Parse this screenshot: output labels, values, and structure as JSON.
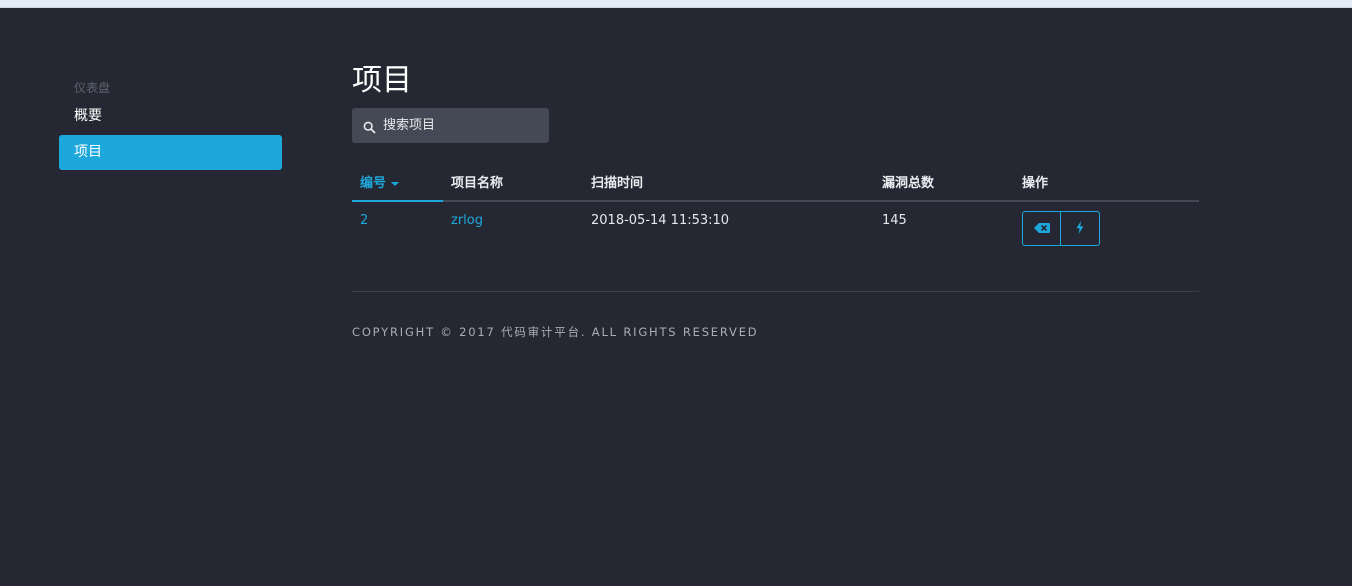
{
  "sidebar": {
    "section_label": "仪表盘",
    "items": [
      {
        "label": "概要",
        "active": false
      },
      {
        "label": "项目",
        "active": true
      }
    ]
  },
  "main": {
    "title": "项目",
    "search": {
      "placeholder": "搜索项目",
      "icon": "search-icon"
    },
    "table": {
      "columns": [
        "编号",
        "项目名称",
        "扫描时间",
        "漏洞总数",
        "操作"
      ],
      "sorted_column": "编号",
      "rows": [
        {
          "id": "2",
          "name": "zrlog",
          "scan_time": "2018-05-14 11:53:10",
          "vuln_total": "145"
        }
      ],
      "actions": [
        {
          "icon": "backspace-icon"
        },
        {
          "icon": "lightning-icon"
        }
      ]
    }
  },
  "footer": {
    "text": "COPYRIGHT © 2017 代码审计平台. ALL RIGHTS RESERVED"
  },
  "colors": {
    "background": "#252832",
    "accent": "#1da8dc",
    "search_bg": "#454955"
  }
}
